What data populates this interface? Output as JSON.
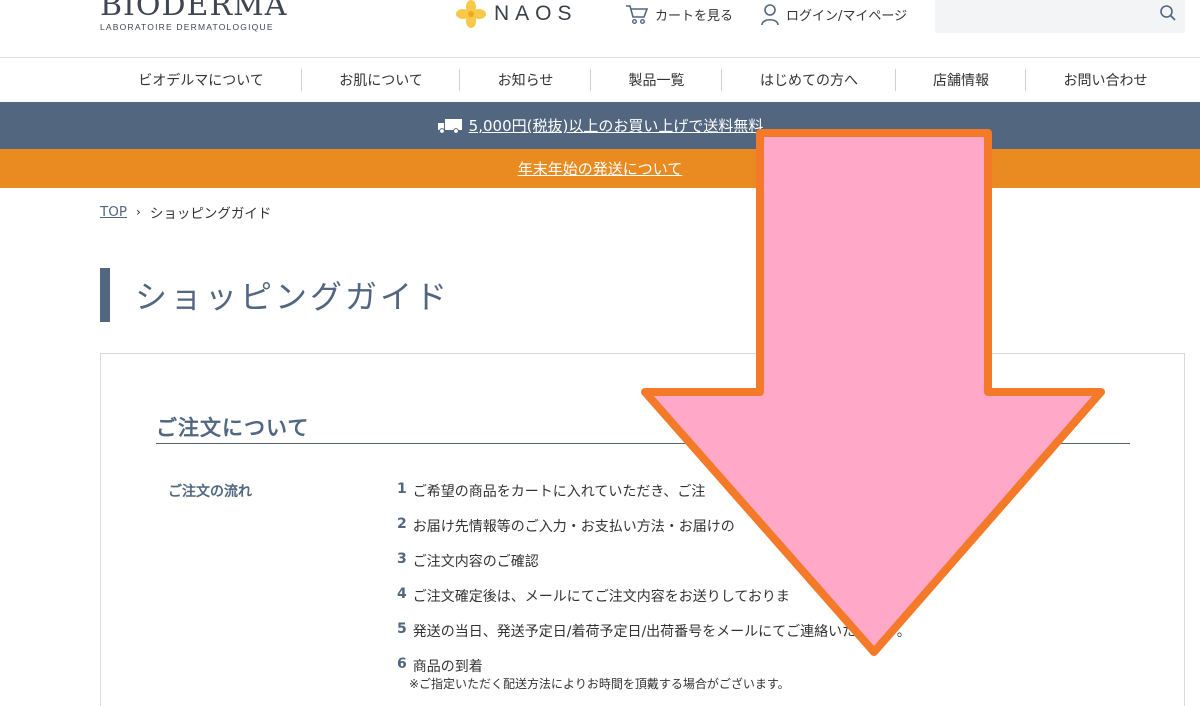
{
  "header": {
    "logo_main": "BIODERMA",
    "logo_sub": "LABORATOIRE DERMATOLOGIQUE",
    "naos_text": "NAOS",
    "cart_label": "カートを見る",
    "login_label": "ログイン/マイページ",
    "search_placeholder": ""
  },
  "nav": {
    "items": [
      {
        "label": "ビオデルマについて"
      },
      {
        "label": "お肌について"
      },
      {
        "label": "お知らせ"
      },
      {
        "label": "製品一覧"
      },
      {
        "label": "はじめての方へ"
      },
      {
        "label": "店舗情報"
      },
      {
        "label": "お問い合わせ"
      }
    ]
  },
  "banners": {
    "shipping": "5,000円(税抜)以上のお買い上げで送料無料",
    "notice": "年末年始の発送について"
  },
  "breadcrumb": {
    "home": "TOP",
    "separator": "›",
    "current": "ショッピングガイド"
  },
  "page": {
    "title": "ショッピングガイド"
  },
  "section": {
    "title": "ご注文について",
    "flow_label": "ご注文の流れ",
    "steps": [
      {
        "num": "1",
        "text": "ご希望の商品をカートに入れていただき、ご注"
      },
      {
        "num": "2",
        "text": "お届け先情報等のご入力・お支払い方法・お届けの"
      },
      {
        "num": "3",
        "text": "ご注文内容のご確認"
      },
      {
        "num": "4",
        "text": "ご注文確定後は、メールにてご注文内容をお送りしておりま"
      },
      {
        "num": "5",
        "text": "発送の当日、発送予定日/着荷予定日/出荷番号をメールにてご連絡いたします。"
      },
      {
        "num": "6",
        "text": "商品の到着"
      }
    ],
    "note": "※ご指定いただく配送方法によりお時間を頂戴する場合がございます。"
  },
  "colors": {
    "brand_blue": "#52677f",
    "notice_orange": "#ea8b22",
    "arrow_fill": "#ffa8c8",
    "arrow_stroke": "#f47a2a"
  }
}
